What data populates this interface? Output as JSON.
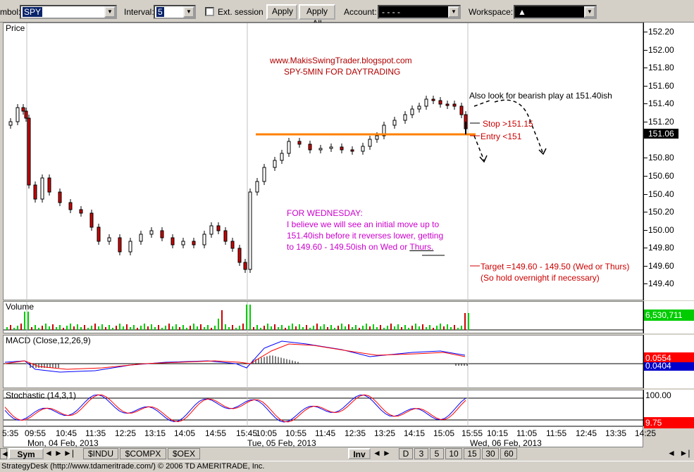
{
  "toolbar": {
    "symbol_label": "mbol:",
    "symbol_value": "SPY",
    "interval_label": "Interval:",
    "interval_value": "5",
    "ext_session_label": "Ext. session",
    "apply_label": "Apply",
    "apply_all_label": "Apply All",
    "account_label": "Account:",
    "account_value": "- - - -",
    "workspace_label": "Workspace:",
    "workspace_value": "▲"
  },
  "price_pane": {
    "title": "Price",
    "y_labels": [
      "152.20",
      "152.00",
      "151.80",
      "151.60",
      "151.40",
      "151.20",
      "151.06",
      "150.80",
      "150.60",
      "150.40",
      "150.20",
      "150.00",
      "149.80",
      "149.60",
      "149.40"
    ],
    "current": "151.06"
  },
  "annotations": {
    "site": "www.MakisSwingTrader.blogspot.com",
    "subtitle": "SPY-5MIN FOR DAYTRADING",
    "bearish": "Also look for bearish play at 151.40ish",
    "stop": "Stop >151.15",
    "entry": "Entry <151",
    "wed_title": "FOR WEDNESDAY:",
    "wed_line1": "I believe we will see an initial move up to",
    "wed_line2": "151.40ish before it reverses lower, getting",
    "wed_line3a": "to 149.60 - 149.50ish on Wed or ",
    "wed_line3b": "Thurs.",
    "target": "Target =149.60 - 149.50 (Wed or Thurs)",
    "hold": "(So hold overnight if necessary)"
  },
  "volume_pane": {
    "title": "Volume",
    "value": "6,530,711"
  },
  "macd_pane": {
    "title": "MACD (Close,12,26,9)",
    "value1": "0.0554",
    "value2": "0.0404"
  },
  "stoch_pane": {
    "title": "Stochastic (14,3,1)",
    "top": "100.00",
    "value": "9.75"
  },
  "time_axis": {
    "labels": [
      "5:35",
      "09:55",
      "10:45",
      "11:35",
      "12:25",
      "13:15",
      "14:05",
      "14:55",
      "15:45",
      "10:05",
      "10:55",
      "11:45",
      "12:35",
      "13:25",
      "14:15",
      "15:05",
      "15:55",
      "10:15",
      "11:05",
      "11:55",
      "12:45",
      "13:35",
      "14:25"
    ],
    "dates": [
      "Mon, 04 Feb, 2013",
      "Tue, 05 Feb, 2013",
      "Wed, 06 Feb, 2013"
    ]
  },
  "tabs": {
    "sym": "Sym",
    "symbols": [
      "$INDU",
      "$COMPX",
      "$OEX"
    ],
    "inv": "Inv",
    "intervals": [
      "D",
      "3",
      "5",
      "10",
      "15",
      "30",
      "60"
    ]
  },
  "status": "StrategyDesk (http://www.tdameritrade.com/) © 2006 TD AMERITRADE, Inc.",
  "colors": {
    "orange_line": "#ff8000",
    "up": "#000000",
    "down": "#cc0000",
    "macd": "#0000ff",
    "signal": "#ff0000",
    "volume_up": "#00cc00",
    "volume_down": "#cc0000"
  }
}
